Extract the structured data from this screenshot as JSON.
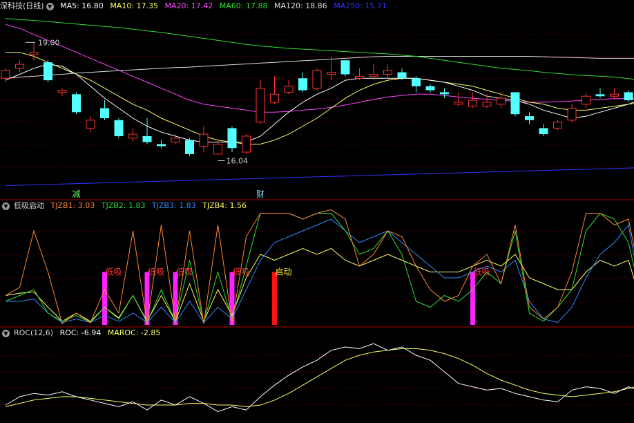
{
  "panel1": {
    "title": "深科技(日线)",
    "ma": [
      {
        "label": "MA5: 16.80",
        "color": "#ffffff"
      },
      {
        "label": "MA10: 17.35",
        "color": "#ffff66"
      },
      {
        "label": "MA20: 17.42",
        "color": "#ff44ff"
      },
      {
        "label": "MA60: 17.88",
        "color": "#33dd33"
      },
      {
        "label": "MA120: 18.86",
        "color": "#dddddd"
      },
      {
        "label": "MA250: 15.71",
        "color": "#3333ff"
      }
    ],
    "high_label": "19.00",
    "low_label": "16.04",
    "markers": [
      "减",
      "财"
    ]
  },
  "panel2": {
    "title": "低吸启动",
    "lines": [
      {
        "label": "TJZB1: 3.03",
        "color": "#ff8833"
      },
      {
        "label": "TJZB2: 1.83",
        "color": "#33dd33"
      },
      {
        "label": "TJZB3: 1.83",
        "color": "#3388ff"
      },
      {
        "label": "TJZB4: 1.56",
        "color": "#ffff66"
      }
    ],
    "signal_low": "低吸",
    "signal_start": "启动"
  },
  "panel3": {
    "title": "ROC(12,6)",
    "lines": [
      {
        "label": "ROC: -6.94",
        "color": "#ffffff"
      },
      {
        "label": "MAROC: -2.85",
        "color": "#ffff66"
      }
    ]
  },
  "colors": {
    "up": "#ff3333",
    "down": "#54ffff",
    "magenta": "#ff22ff",
    "grid": "#8a0000",
    "sep": "#b00000"
  },
  "chart_data": {
    "type": "candlestick",
    "ylim": [
      15.2,
      19.6
    ],
    "candles": [
      [
        17.95,
        18.15,
        17.85,
        18.2
      ],
      [
        18.2,
        18.3,
        18.1,
        18.4
      ],
      [
        18.55,
        18.6,
        18.4,
        18.85
      ],
      [
        18.35,
        17.9,
        17.85,
        18.4
      ],
      [
        17.6,
        17.65,
        17.5,
        17.7
      ],
      [
        17.55,
        17.1,
        17.05,
        17.6
      ],
      [
        16.7,
        16.9,
        16.6,
        17.0
      ],
      [
        17.2,
        16.95,
        16.9,
        17.4
      ],
      [
        16.9,
        16.5,
        16.45,
        16.95
      ],
      [
        16.45,
        16.55,
        16.35,
        16.7
      ],
      [
        16.5,
        16.35,
        16.3,
        16.95
      ],
      [
        16.3,
        16.25,
        16.2,
        16.4
      ],
      [
        16.35,
        16.45,
        16.3,
        16.55
      ],
      [
        16.4,
        16.05,
        16.0,
        16.45
      ],
      [
        16.25,
        16.55,
        16.1,
        16.75
      ],
      [
        16.05,
        16.3,
        16.04,
        16.4
      ],
      [
        16.7,
        16.2,
        16.1,
        16.75
      ],
      [
        16.1,
        16.5,
        16.05,
        16.55
      ],
      [
        16.85,
        17.7,
        16.8,
        17.9
      ],
      [
        17.35,
        17.55,
        17.3,
        18.0
      ],
      [
        17.6,
        17.75,
        17.55,
        17.9
      ],
      [
        17.95,
        17.65,
        17.6,
        18.1
      ],
      [
        17.7,
        18.15,
        17.65,
        18.2
      ],
      [
        18.05,
        18.1,
        17.9,
        18.5
      ],
      [
        18.4,
        18.05,
        18.0,
        18.4
      ],
      [
        17.95,
        18.0,
        17.9,
        18.2
      ],
      [
        18.0,
        18.05,
        17.9,
        18.3
      ],
      [
        18.05,
        18.15,
        17.95,
        18.3
      ],
      [
        18.1,
        17.95,
        17.9,
        18.2
      ],
      [
        17.95,
        17.75,
        17.6,
        18.0
      ],
      [
        17.75,
        17.65,
        17.6,
        17.8
      ],
      [
        17.6,
        17.55,
        17.45,
        17.7
      ],
      [
        17.3,
        17.35,
        17.25,
        17.6
      ],
      [
        17.25,
        17.4,
        17.2,
        17.6
      ],
      [
        17.25,
        17.35,
        17.2,
        17.55
      ],
      [
        17.3,
        17.45,
        17.2,
        17.6
      ],
      [
        17.6,
        17.05,
        17.0,
        17.6
      ],
      [
        17.0,
        16.9,
        16.8,
        17.1
      ],
      [
        16.7,
        16.55,
        16.5,
        16.8
      ],
      [
        16.7,
        16.85,
        16.65,
        16.9
      ],
      [
        16.9,
        17.2,
        16.85,
        17.3
      ],
      [
        17.3,
        17.5,
        17.2,
        17.6
      ],
      [
        17.55,
        17.5,
        17.45,
        17.7
      ],
      [
        17.5,
        17.55,
        17.45,
        17.7
      ],
      [
        17.6,
        17.4,
        17.35,
        17.65
      ],
      [
        17.35,
        17.65,
        17.3,
        17.85
      ]
    ],
    "ma5": [
      17.9,
      18.05,
      18.2,
      18.3,
      18.25,
      18.05,
      17.75,
      17.45,
      17.2,
      16.95,
      16.75,
      16.6,
      16.5,
      16.4,
      16.35,
      16.35,
      16.35,
      16.35,
      16.5,
      16.8,
      17.1,
      17.35,
      17.55,
      17.7,
      17.9,
      17.95,
      17.95,
      17.95,
      17.95,
      17.95,
      17.9,
      17.85,
      17.75,
      17.65,
      17.5,
      17.45,
      17.4,
      17.3,
      17.15,
      17.05,
      16.95,
      17.0,
      17.1,
      17.2,
      17.3,
      17.45
    ],
    "ma10": [
      18.6,
      18.6,
      18.5,
      18.35,
      18.2,
      18.05,
      17.9,
      17.7,
      17.5,
      17.3,
      17.15,
      16.95,
      16.8,
      16.65,
      16.5,
      16.4,
      16.35,
      16.3,
      16.3,
      16.4,
      16.55,
      16.75,
      16.95,
      17.2,
      17.45,
      17.65,
      17.8,
      17.9,
      17.95,
      17.95,
      17.9,
      17.85,
      17.8,
      17.75,
      17.65,
      17.55,
      17.45,
      17.35,
      17.3,
      17.2,
      17.15,
      17.15,
      17.2,
      17.25,
      17.3,
      17.35
    ],
    "ma20": [
      19.3,
      19.2,
      19.05,
      18.9,
      18.75,
      18.6,
      18.45,
      18.3,
      18.15,
      18.0,
      17.85,
      17.7,
      17.55,
      17.4,
      17.3,
      17.25,
      17.2,
      17.15,
      17.1,
      17.1,
      17.12,
      17.15,
      17.18,
      17.22,
      17.28,
      17.35,
      17.42,
      17.48,
      17.52,
      17.55,
      17.55,
      17.52,
      17.48,
      17.45,
      17.42,
      17.4,
      17.37,
      17.35,
      17.35,
      17.36,
      17.38,
      17.4,
      17.42,
      17.44,
      17.44,
      17.44
    ],
    "ma60": [
      19.45,
      19.42,
      19.4,
      19.37,
      19.34,
      19.31,
      19.28,
      19.25,
      19.22,
      19.18,
      19.14,
      19.1,
      19.05,
      19.0,
      18.95,
      18.9,
      18.85,
      18.8,
      18.76,
      18.73,
      18.7,
      18.68,
      18.66,
      18.64,
      18.62,
      18.6,
      18.58,
      18.56,
      18.53,
      18.5,
      18.45,
      18.4,
      18.35,
      18.3,
      18.25,
      18.2,
      18.17,
      18.14,
      18.1,
      18.07,
      18.04,
      18.02,
      18.0,
      17.98,
      17.94,
      17.9
    ],
    "ma120": [
      17.95,
      17.98,
      18.0,
      18.03,
      18.05,
      18.08,
      18.1,
      18.12,
      18.14,
      18.16,
      18.18,
      18.2,
      18.22,
      18.23,
      18.25,
      18.27,
      18.29,
      18.31,
      18.33,
      18.35,
      18.37,
      18.39,
      18.41,
      18.43,
      18.45,
      18.47,
      18.49,
      18.5,
      18.5,
      18.5,
      18.5,
      18.5,
      18.5,
      18.5,
      18.5,
      18.5,
      18.5,
      18.5,
      18.49,
      18.48,
      18.47,
      18.46,
      18.45,
      18.45,
      18.45,
      18.45
    ],
    "ma250": [
      15.26,
      15.27,
      15.28,
      15.29,
      15.3,
      15.31,
      15.32,
      15.33,
      15.34,
      15.35,
      15.36,
      15.37,
      15.38,
      15.39,
      15.4,
      15.41,
      15.42,
      15.43,
      15.44,
      15.45,
      15.46,
      15.47,
      15.48,
      15.49,
      15.5,
      15.51,
      15.52,
      15.53,
      15.54,
      15.55,
      15.56,
      15.57,
      15.58,
      15.59,
      15.6,
      15.61,
      15.62,
      15.63,
      15.64,
      15.65,
      15.66,
      15.67,
      15.68,
      15.69,
      15.7,
      15.71
    ],
    "high_index": 2,
    "low_index": 15,
    "marker_index": [
      5,
      18
    ],
    "indicator": {
      "ylim": [
        0,
        10
      ],
      "tjzb1": [
        2.5,
        3.2,
        8.0,
        4.5,
        0.1,
        1.0,
        0.2,
        3.0,
        1.0,
        8.0,
        0.1,
        8.5,
        0.2,
        8.0,
        0.1,
        8.5,
        0.2,
        7.5,
        9.5,
        9.5,
        9.5,
        9.0,
        9.5,
        9.8,
        9.0,
        5.0,
        6.0,
        8.0,
        7.5,
        5.0,
        3.0,
        2.0,
        2.5,
        5.0,
        6.0,
        3.5,
        8.5,
        1.5,
        0.5,
        1.5,
        4.5,
        9.5,
        9.5,
        8.5,
        9.0,
        3.0
      ],
      "tjzb2": [
        2.0,
        2.5,
        3.0,
        1.0,
        0.3,
        0.8,
        0.2,
        1.5,
        0.5,
        2.5,
        0.2,
        3.0,
        0.3,
        5.5,
        0.2,
        4.5,
        0.5,
        5.0,
        9.5,
        9.5,
        9.5,
        9.0,
        9.5,
        9.5,
        8.0,
        6.0,
        6.5,
        8.0,
        6.0,
        2.0,
        1.5,
        2.5,
        2.0,
        3.0,
        4.5,
        3.5,
        8.0,
        1.0,
        0.3,
        1.5,
        3.0,
        8.0,
        9.5,
        9.0,
        7.0,
        1.8
      ],
      "tjzb3": [
        2.0,
        2.0,
        2.2,
        1.0,
        0.2,
        0.5,
        0.2,
        0.8,
        0.3,
        1.0,
        0.2,
        1.5,
        0.2,
        2.0,
        0.2,
        1.5,
        0.5,
        3.0,
        5.5,
        7.0,
        7.5,
        8.0,
        8.5,
        9.0,
        8.0,
        7.0,
        7.5,
        8.0,
        7.0,
        6.0,
        5.0,
        4.0,
        4.0,
        4.5,
        5.0,
        4.5,
        5.5,
        2.0,
        0.5,
        0.2,
        1.5,
        4.0,
        6.0,
        7.0,
        8.5,
        1.8
      ],
      "tjzb4": [
        2.5,
        2.7,
        2.8,
        1.5,
        0.3,
        1.0,
        0.3,
        1.5,
        0.6,
        2.5,
        0.3,
        2.5,
        0.3,
        3.5,
        0.3,
        3.0,
        0.8,
        4.0,
        6.0,
        5.5,
        6.0,
        6.5,
        6.0,
        6.5,
        5.5,
        5.0,
        5.5,
        6.0,
        5.5,
        5.0,
        4.5,
        4.5,
        4.5,
        5.0,
        5.5,
        5.0,
        6.0,
        4.0,
        3.5,
        3.0,
        3.0,
        4.5,
        5.5,
        5.0,
        5.5,
        1.5
      ],
      "low_signals": [
        7,
        10,
        12,
        16,
        33
      ],
      "start_signals": [
        19
      ],
      "bar_height": 4.5
    },
    "roc": {
      "ylim": [
        -25,
        25
      ],
      "roc": [
        -15,
        -10,
        -8,
        -9,
        -7,
        -10,
        -12,
        -14,
        -16,
        -13,
        -18,
        -12,
        -15,
        -10,
        -14,
        -19,
        -16,
        -18,
        -10,
        -3,
        3,
        8,
        12,
        18,
        20,
        19,
        22,
        18,
        20,
        15,
        12,
        5,
        -2,
        -4,
        -6,
        -5,
        -8,
        -10,
        -12,
        -13,
        -6,
        -4,
        -5,
        -8,
        -4,
        -6.94
      ],
      "maroc": [
        -16,
        -14,
        -12,
        -11,
        -10,
        -10,
        -11,
        -12,
        -13,
        -14,
        -15,
        -15,
        -15,
        -14,
        -14,
        -15,
        -15,
        -16,
        -15,
        -12,
        -8,
        -3,
        2,
        7,
        12,
        15,
        17,
        18,
        19,
        19,
        18,
        16,
        13,
        9,
        4,
        0,
        -3,
        -6,
        -8,
        -9,
        -10,
        -9,
        -8,
        -7,
        -5,
        -2.85
      ]
    }
  }
}
